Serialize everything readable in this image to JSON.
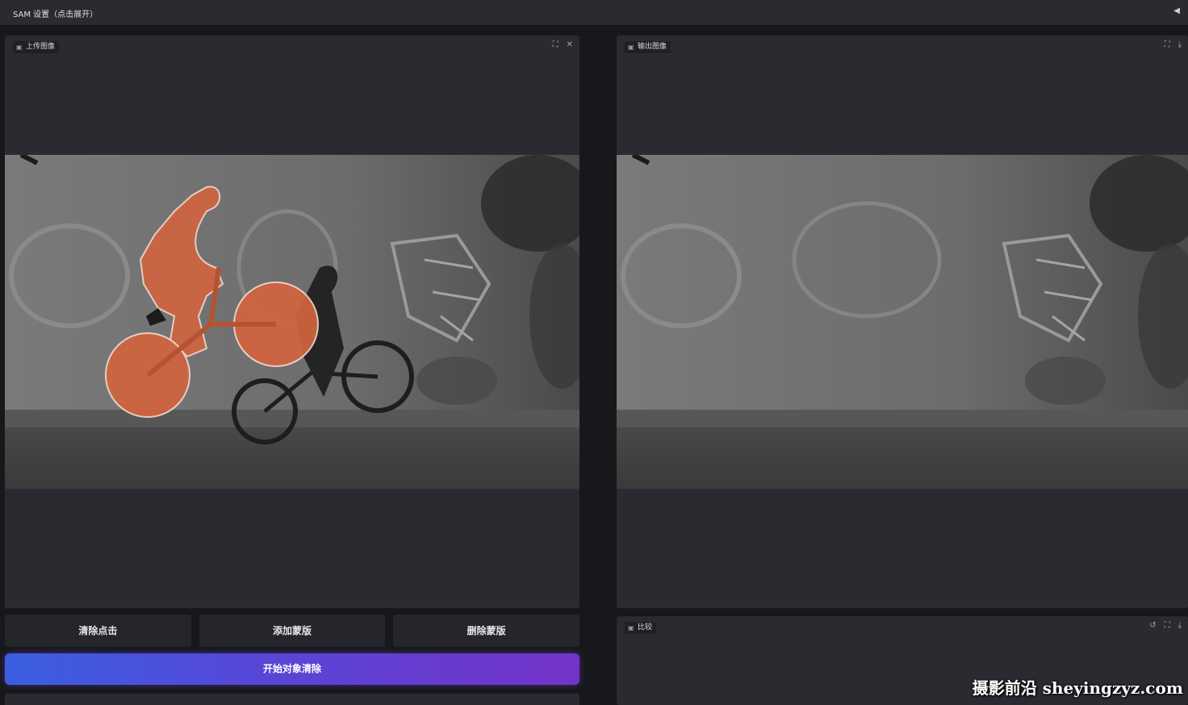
{
  "topbar": {
    "title": "SAM 设置（点击展开）",
    "collapse_icon": "◀"
  },
  "upload_panel": {
    "label": "上传图像",
    "icon": "image-icon",
    "tools": [
      "expand-icon",
      "close-icon"
    ]
  },
  "output_panel": {
    "label": "输出图像",
    "icon": "image-icon",
    "tools": [
      "expand-icon",
      "download-icon"
    ]
  },
  "compare_panel": {
    "label": "比较",
    "icon": "image-icon",
    "tools": [
      "reset-icon",
      "expand-icon",
      "download-icon"
    ]
  },
  "buttons": {
    "clear_clicks": "清除点击",
    "add_mask": "添加蒙版",
    "remove_mask": "删除蒙版",
    "start": "开始对象清除"
  },
  "watermark": "摄影前沿 sheyingzyz.com",
  "colors": {
    "accent_start": "#3a5fe0",
    "accent_end": "#7433c8",
    "mask": "#d2643f",
    "panel": "#2a2b30",
    "background": "#17181c"
  }
}
